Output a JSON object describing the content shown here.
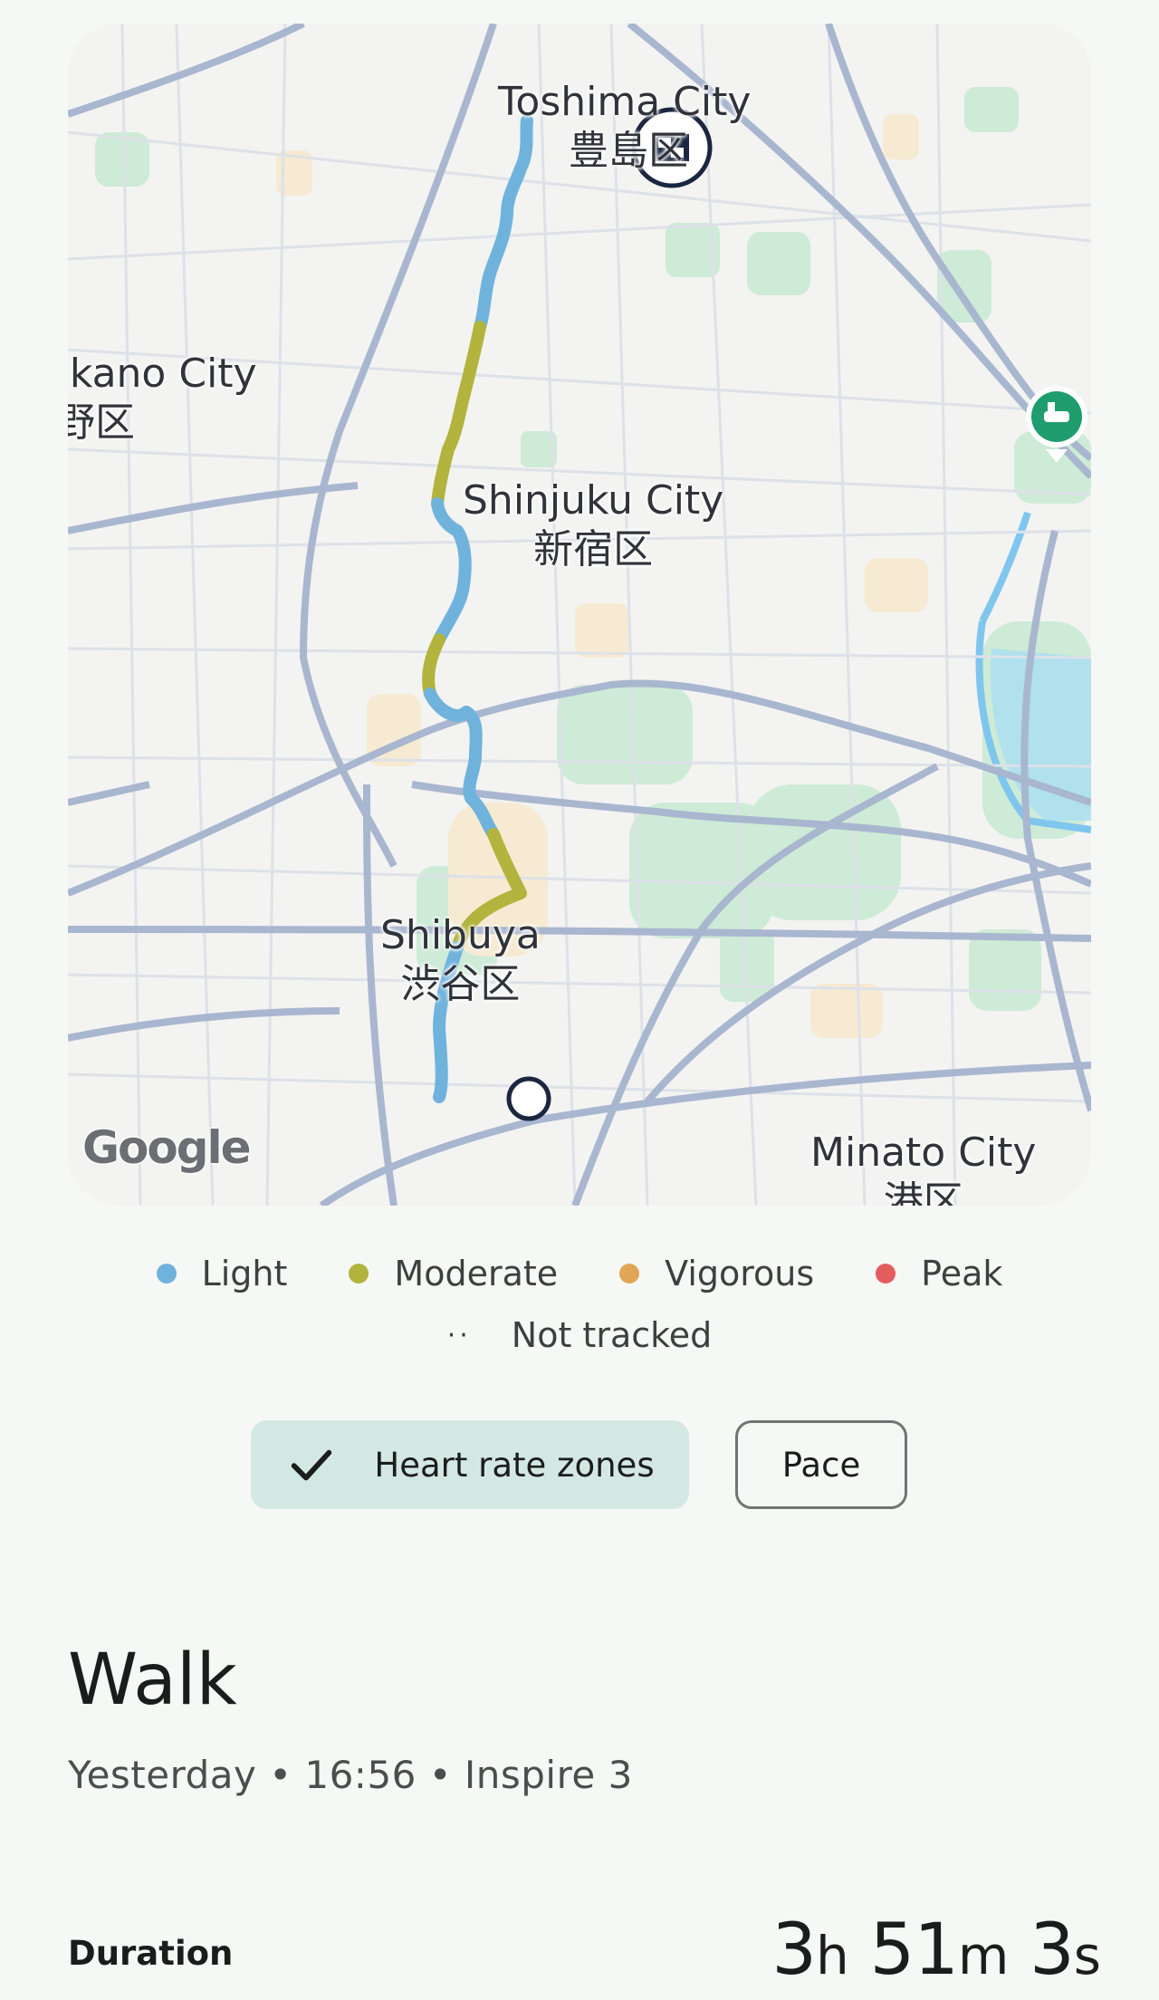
{
  "map": {
    "labels": {
      "toshima_en": "Toshima City",
      "toshima_ja": "豊島区",
      "nakano_en": "Nakano City",
      "nakano_ja": "中野区",
      "shinjuku_en": "Shinjuku City",
      "shinjuku_ja": "新宿区",
      "shibuya_en": "Shibuya",
      "shibuya_ja": "渋谷区",
      "minato_en": "Minato City",
      "minato_ja": "港区"
    },
    "attribution": "Google",
    "finish_icon": "finish-flag-icon",
    "start_icon": "start-marker-icon",
    "poi_icon": "poi-pin-icon"
  },
  "legend": {
    "items": [
      {
        "label": "Light",
        "color": "#6fb3dc"
      },
      {
        "label": "Moderate",
        "color": "#b2b43e"
      },
      {
        "label": "Vigorous",
        "color": "#e0a656"
      },
      {
        "label": "Peak",
        "color": "#e45d5d"
      }
    ],
    "not_tracked": "Not tracked"
  },
  "chips": {
    "heart_rate_zones": "Heart rate zones",
    "pace": "Pace"
  },
  "activity": {
    "title": "Walk",
    "subtitle": "Yesterday • 16:56 • Inspire 3"
  },
  "stats": {
    "duration_label": "Duration",
    "duration": {
      "h": "3",
      "h_unit": "h",
      "m": "51",
      "m_unit": "m",
      "s": "3",
      "s_unit": "s"
    }
  },
  "colors": {
    "accent_chip": "#d3e8e3",
    "route_light": "#6fb3dc",
    "route_moderate": "#b2b43e",
    "road": "#a9b6cf",
    "park": "#cdebd6"
  }
}
